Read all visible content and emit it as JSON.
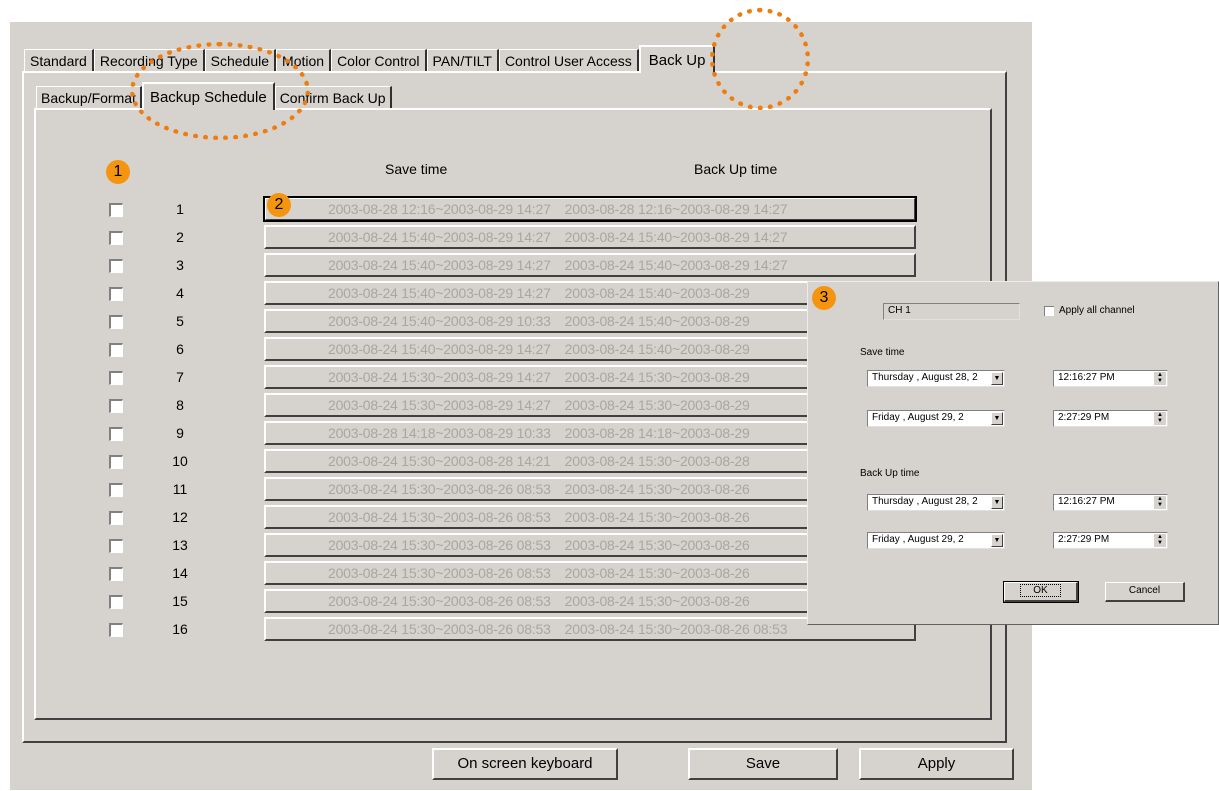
{
  "tabs": [
    "Standard",
    "Recording Type",
    "Schedule",
    "Motion",
    "Color Control",
    "PAN/TILT",
    "Control User Access",
    "Back Up"
  ],
  "active_tab": "Back Up",
  "sub_tabs": [
    "Backup/Format",
    "Backup Schedule",
    "Confirm Back Up"
  ],
  "active_sub_tab": "Backup Schedule",
  "columns": {
    "save_time": "Save time",
    "backup_time": "Back Up time"
  },
  "rows": [
    {
      "num": "1",
      "save": "2003-08-28 12:16~2003-08-29 14:27",
      "backup": "2003-08-28 12:16~2003-08-29 14:27"
    },
    {
      "num": "2",
      "save": "2003-08-24 15:40~2003-08-29 14:27",
      "backup": "2003-08-24 15:40~2003-08-29 14:27"
    },
    {
      "num": "3",
      "save": "2003-08-24 15:40~2003-08-29 14:27",
      "backup": "2003-08-24 15:40~2003-08-29 14:27"
    },
    {
      "num": "4",
      "save": "2003-08-24 15:40~2003-08-29 14:27",
      "backup": "2003-08-24 15:40~2003-08-29"
    },
    {
      "num": "5",
      "save": "2003-08-24 15:40~2003-08-29 10:33",
      "backup": "2003-08-24 15:40~2003-08-29"
    },
    {
      "num": "6",
      "save": "2003-08-24 15:40~2003-08-29 14:27",
      "backup": "2003-08-24 15:40~2003-08-29"
    },
    {
      "num": "7",
      "save": "2003-08-24 15:30~2003-08-29 14:27",
      "backup": "2003-08-24 15:30~2003-08-29"
    },
    {
      "num": "8",
      "save": "2003-08-24 15:30~2003-08-29 14:27",
      "backup": "2003-08-24 15:30~2003-08-29"
    },
    {
      "num": "9",
      "save": "2003-08-28 14:18~2003-08-29 10:33",
      "backup": "2003-08-28 14:18~2003-08-29"
    },
    {
      "num": "10",
      "save": "2003-08-24 15:30~2003-08-28 14:21",
      "backup": "2003-08-24 15:30~2003-08-28"
    },
    {
      "num": "11",
      "save": "2003-08-24 15:30~2003-08-26 08:53",
      "backup": "2003-08-24 15:30~2003-08-26"
    },
    {
      "num": "12",
      "save": "2003-08-24 15:30~2003-08-26 08:53",
      "backup": "2003-08-24 15:30~2003-08-26"
    },
    {
      "num": "13",
      "save": "2003-08-24 15:30~2003-08-26 08:53",
      "backup": "2003-08-24 15:30~2003-08-26"
    },
    {
      "num": "14",
      "save": "2003-08-24 15:30~2003-08-26 08:53",
      "backup": "2003-08-24 15:30~2003-08-26"
    },
    {
      "num": "15",
      "save": "2003-08-24 15:30~2003-08-26 08:53",
      "backup": "2003-08-24 15:30~2003-08-26"
    },
    {
      "num": "16",
      "save": "2003-08-24 15:30~2003-08-26 08:53",
      "backup": "2003-08-24 15:30~2003-08-26 08:53"
    }
  ],
  "buttons": {
    "keyboard": "On screen keyboard",
    "save": "Save",
    "apply": "Apply"
  },
  "markers": [
    "1",
    "2",
    "3"
  ],
  "dialog": {
    "channel": "CH 1",
    "apply_all": "Apply all channel",
    "save_time_label": "Save time",
    "backup_time_label": "Back Up time",
    "save_start_day": "Thursday",
    "save_start_date": "August   28, 2",
    "save_start_time": "12:16:27 PM",
    "save_end_day": "Friday",
    "save_end_date": "August   29, 2",
    "save_end_time": "2:27:29 PM",
    "backup_start_day": "Thursday",
    "backup_start_date": "August   28, 2",
    "backup_start_time": "12:16:27 PM",
    "backup_end_day": "Friday",
    "backup_end_date": "August   29, 2",
    "backup_end_time": "2:27:29 PM",
    "ok": "OK",
    "cancel": "Cancel"
  },
  "colors": {
    "panel": "#d6d3ce",
    "marker": "#f5940f",
    "highlight_ring": "#ef7c0e",
    "disabled_text": "#a9a6a1"
  }
}
